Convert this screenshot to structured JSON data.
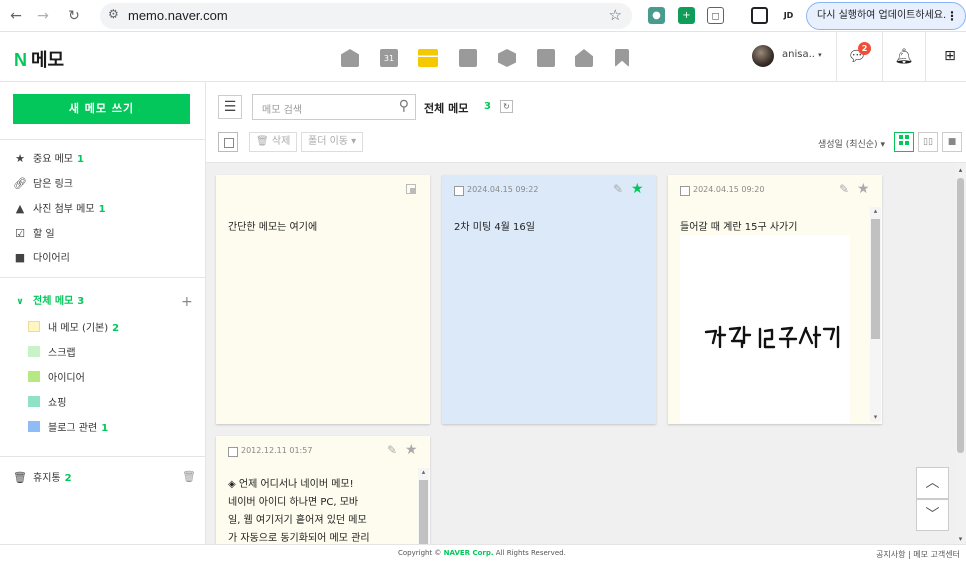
{
  "browser": {
    "url": "memo.naver.com",
    "update_button": "다시 실행하여 업데이트하세요.",
    "profile_initials": "JD"
  },
  "header": {
    "logo_n": "N",
    "logo_text": "메모",
    "calendar_day": "31",
    "username": "anisa..",
    "username_caret": "▾",
    "chat_badge": "2"
  },
  "sidebar": {
    "new_memo": "새 메모 쓰기",
    "quick": [
      {
        "label": "중요 메모",
        "count": "1",
        "icon": "star-icon"
      },
      {
        "label": "담은 링크",
        "count": "",
        "icon": "link-icon"
      },
      {
        "label": "사진 첨부 메모",
        "count": "1",
        "icon": "photo-icon"
      },
      {
        "label": "할 일",
        "count": "",
        "icon": "checkbox-icon"
      },
      {
        "label": "다이어리",
        "count": "",
        "icon": "diary-icon"
      }
    ],
    "all_memo": {
      "label": "전체 메모",
      "count": "3"
    },
    "folders": [
      {
        "label": "내 메모 (기본)",
        "count": "2",
        "color": "#fff6c1"
      },
      {
        "label": "스크랩",
        "count": "",
        "color": "#c9f2c6"
      },
      {
        "label": "아이디어",
        "count": "",
        "color": "#b6e981"
      },
      {
        "label": "쇼핑",
        "count": "",
        "color": "#8fe2c5"
      },
      {
        "label": "블로그 관련",
        "count": "1",
        "color": "#8fbcf5"
      }
    ],
    "trash": {
      "label": "휴지통",
      "count": "2"
    }
  },
  "toolbar": {
    "search_placeholder": "메모 검색",
    "folder_title": "전체 메모",
    "folder_count": "3",
    "delete_label": "삭제",
    "move_label": "폴더 이동",
    "sort_label": "생성일 (최신순)"
  },
  "cards": [
    {
      "date": "",
      "text": "간단한 메모는 여기에",
      "color": "#fdfcee",
      "starred": false
    },
    {
      "date": "2024.04.15 09:22",
      "text": "2차 미팅 4월 16일",
      "color": "#dce9f9",
      "starred": true
    },
    {
      "date": "2024.04.15 09:20",
      "text": "들어갈 때 계란 15구 사가기",
      "color": "#fdfcee",
      "starred": false,
      "handwriting": "계란 15구 사기"
    },
    {
      "date": "2012.12.11 01:57",
      "text_lines": [
        "◈ 언제 어디서나 네이버 메모!",
        "네이버 아이디 하나면 PC, 모바",
        "일, 웹 여기저기 흩어져 있던 메모",
        "가 자동으로 동기화되어 메모 관리"
      ],
      "color": "#fdfcee",
      "starred": false
    }
  ],
  "colors": {
    "accent": "#03c75a",
    "star_on": "#03c75a",
    "star_off": "#aaaaaa"
  },
  "footer": {
    "copyright_prefix": "Copyright © ",
    "copyright_brand": "NAVER Corp.",
    "copyright_suffix": " All Rights Reserved.",
    "links": "공지사항 | 메모 고객센터"
  }
}
